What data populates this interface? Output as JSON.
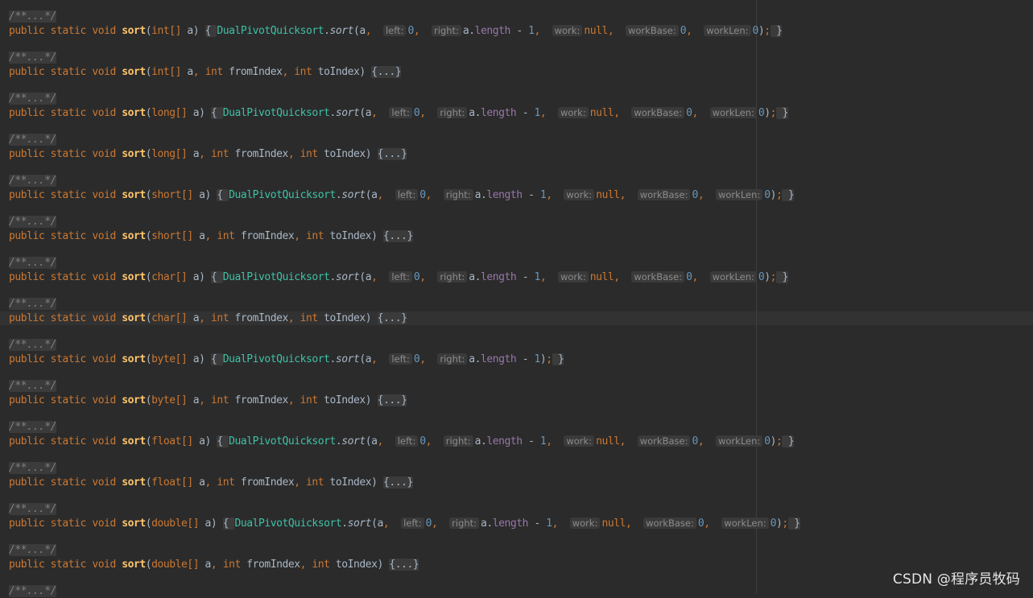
{
  "code": {
    "fold_comment": "/**...*/",
    "fold_body": "{...}",
    "kw_public": "public",
    "kw_static": "static",
    "kw_void": "void",
    "method_name": "sort",
    "class_name": "DualPivotQuicksort",
    "call_method": "sort",
    "var_a": "a",
    "field_length": "length",
    "kw_int": "int",
    "kw_null": "null",
    "param_fromIndex": "fromIndex",
    "param_toIndex": "toIndex",
    "hints": {
      "left": "left:",
      "right": "right:",
      "work": "work:",
      "workBase": "workBase:",
      "workLen": "workLen:"
    },
    "numbers": {
      "zero": "0",
      "one": "1"
    },
    "methods": [
      {
        "array_type": "int[]",
        "kind": "full"
      },
      {
        "array_type": "int[]",
        "kind": "range"
      },
      {
        "array_type": "long[]",
        "kind": "full"
      },
      {
        "array_type": "long[]",
        "kind": "range"
      },
      {
        "array_type": "short[]",
        "kind": "full"
      },
      {
        "array_type": "short[]",
        "kind": "range"
      },
      {
        "array_type": "char[]",
        "kind": "full"
      },
      {
        "array_type": "char[]",
        "kind": "range"
      },
      {
        "array_type": "byte[]",
        "kind": "short"
      },
      {
        "array_type": "byte[]",
        "kind": "range"
      },
      {
        "array_type": "float[]",
        "kind": "full"
      },
      {
        "array_type": "float[]",
        "kind": "range"
      },
      {
        "array_type": "double[]",
        "kind": "full"
      },
      {
        "array_type": "double[]",
        "kind": "range"
      }
    ],
    "last_comment": "/**...*/"
  },
  "watermark": "CSDN @程序员牧码"
}
